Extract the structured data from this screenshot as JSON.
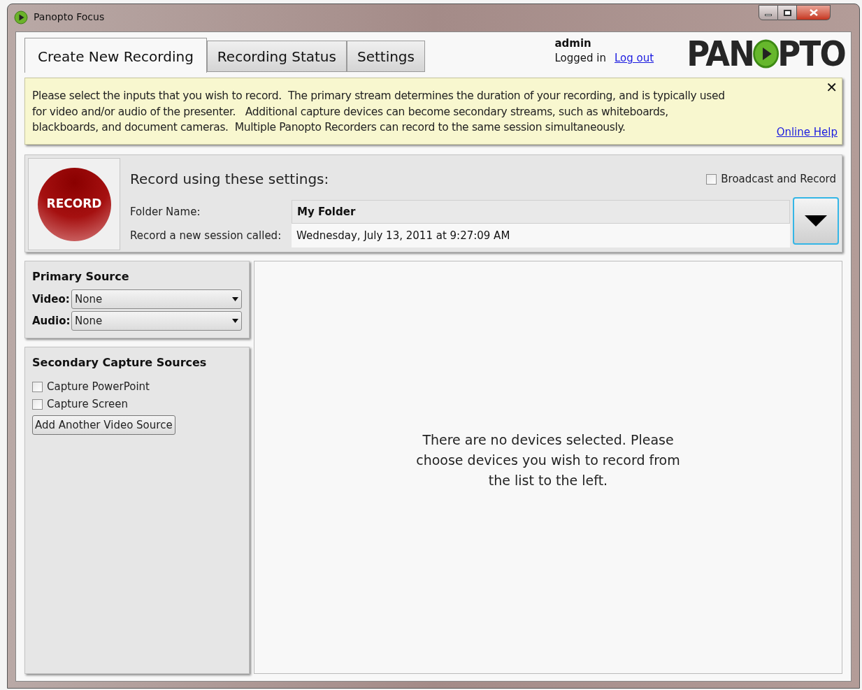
{
  "window": {
    "title": "Panopto Focus"
  },
  "tabs": [
    {
      "label": "Create New Recording",
      "selected": true
    },
    {
      "label": "Recording Status",
      "selected": false
    },
    {
      "label": "Settings",
      "selected": false
    }
  ],
  "user": {
    "name": "admin",
    "status": "Logged in",
    "logout": "Log out"
  },
  "logo": {
    "left": "PAN",
    "right": "PTO"
  },
  "info": {
    "lines": [
      "Please select the inputs that you wish to record.  The primary stream determines the duration of your recording, and is typically used",
      "for video and/or audio of the presenter.   Additional capture devices can become secondary streams, such as whiteboards,",
      "blackboards, and document cameras.  Multiple Panopto Recorders can record to the same session simultaneously."
    ],
    "close": "✕",
    "help": "Online Help"
  },
  "record": {
    "button": "RECORD",
    "heading": "Record using these settings:",
    "broadcast": {
      "label": "Broadcast and Record",
      "checked": false
    },
    "folder_label": "Folder Name:",
    "folder": "My Folder",
    "session_label": "Record a new session called:",
    "session": "Wednesday, July 13, 2011 at 9:27:09 AM"
  },
  "primary": {
    "title": "Primary Source",
    "fields": [
      {
        "label": "Video:",
        "value": "None"
      },
      {
        "label": "Audio:",
        "value": "None"
      }
    ]
  },
  "secondary": {
    "title": "Secondary Capture Sources",
    "options": [
      {
        "label": "Capture PowerPoint",
        "checked": false
      },
      {
        "label": "Capture Screen",
        "checked": false
      }
    ],
    "button": "Add Another Video Source"
  },
  "preview": {
    "message_lines": [
      "There are no devices selected. Please",
      "choose devices you wish to record from",
      "the list to the left."
    ]
  }
}
